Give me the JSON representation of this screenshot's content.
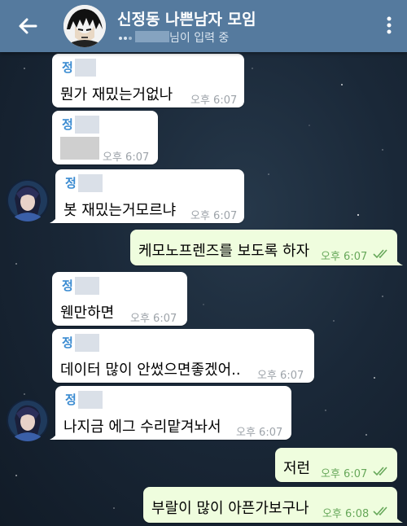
{
  "header": {
    "title": "신정동 나쁜남자 모임",
    "typing_text": "님이 입력 중",
    "back_icon": "arrow-left-icon",
    "menu_icon": "more-vertical-icon",
    "color": "#557a9e"
  },
  "messages": [
    {
      "sender": "정",
      "text": "뭔가 재밌는거없나",
      "time": "오후 6:07"
    },
    {
      "sender": "정",
      "text": "",
      "time": "오후 6:07"
    },
    {
      "sender": "정",
      "text": "봇 재밌는거모르냐",
      "time": "오후 6:07"
    },
    {
      "text": "케모노프렌즈를 보도록 하자",
      "time": "오후 6:07",
      "outgoing": true
    },
    {
      "sender": "정",
      "text": "웬만하면",
      "time": "오후 6:07"
    },
    {
      "sender": "정",
      "text": "데이터 많이 안썼으면좋겠어..",
      "time": "오후 6:07"
    },
    {
      "sender": "정",
      "text": "나지금 에그 수리맡겨놔서",
      "time": "오후 6:07"
    },
    {
      "text": "저런",
      "time": "오후 6:07",
      "outgoing": true
    },
    {
      "text": "부랄이 많이 아픈가보구나",
      "time": "오후 6:08",
      "outgoing": true
    }
  ],
  "colors": {
    "incoming_bubble": "#ffffff",
    "outgoing_bubble": "#effdde",
    "sender_name": "#3a8bd1",
    "outgoing_time": "#67a85a"
  }
}
